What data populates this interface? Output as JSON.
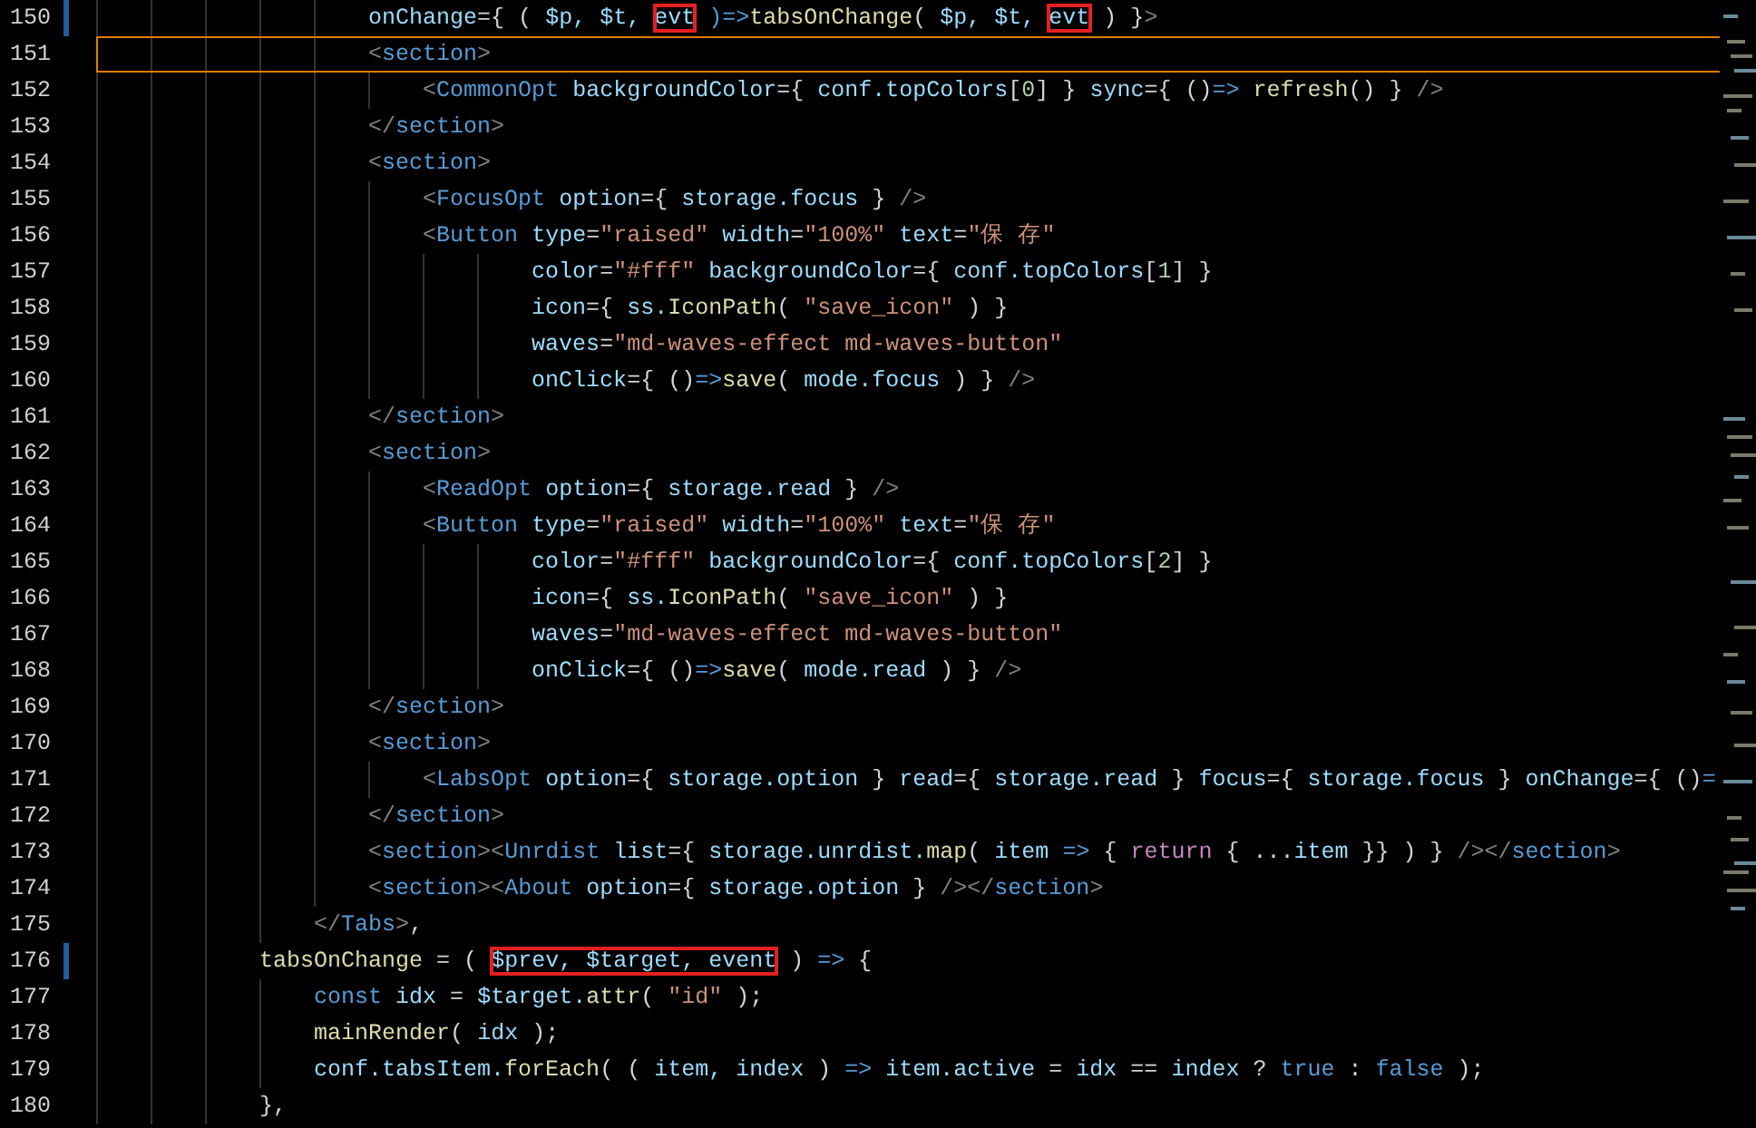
{
  "editor": {
    "lines": [
      {
        "number": "150",
        "modified": true,
        "current": false,
        "tokens": [
          {
            "t": "                      onChange",
            "kind": "attr"
          },
          {
            "t": "={ ( ",
            "kind": "plain"
          },
          {
            "t": "$p, $t, ",
            "kind": "var"
          },
          {
            "t": "evt",
            "kind": "var",
            "boxed": true
          },
          {
            "t": " )=>",
            "kind": "keyword"
          },
          {
            "t": "tabsOnChange",
            "kind": "func"
          },
          {
            "t": "( ",
            "kind": "plain"
          },
          {
            "t": "$p, $t, ",
            "kind": "var"
          },
          {
            "t": "evt",
            "kind": "var",
            "boxed": true
          },
          {
            "t": " ) }",
            "kind": "plain"
          },
          {
            "t": ">",
            "kind": "punct"
          }
        ]
      },
      {
        "number": "151",
        "modified": false,
        "current": true,
        "tokens": [
          {
            "t": "                      <",
            "kind": "punct"
          },
          {
            "t": "section",
            "kind": "tag"
          },
          {
            "t": ">",
            "kind": "punct"
          }
        ]
      },
      {
        "number": "152",
        "modified": false,
        "current": false,
        "tokens": [
          {
            "t": "                          <",
            "kind": "punct"
          },
          {
            "t": "CommonOpt",
            "kind": "tag"
          },
          {
            "t": " backgroundColor",
            "kind": "attr"
          },
          {
            "t": "={ ",
            "kind": "plain"
          },
          {
            "t": "conf.topColors",
            "kind": "var"
          },
          {
            "t": "[",
            "kind": "plain"
          },
          {
            "t": "0",
            "kind": "number"
          },
          {
            "t": "] } ",
            "kind": "plain"
          },
          {
            "t": "sync",
            "kind": "attr"
          },
          {
            "t": "={ ()",
            "kind": "plain"
          },
          {
            "t": "=> ",
            "kind": "keyword"
          },
          {
            "t": "refresh",
            "kind": "func"
          },
          {
            "t": "() } ",
            "kind": "plain"
          },
          {
            "t": "/>",
            "kind": "punct"
          }
        ]
      },
      {
        "number": "153",
        "modified": false,
        "current": false,
        "tokens": [
          {
            "t": "                      </",
            "kind": "punct"
          },
          {
            "t": "section",
            "kind": "tag"
          },
          {
            "t": ">",
            "kind": "punct"
          }
        ]
      },
      {
        "number": "154",
        "modified": false,
        "current": false,
        "tokens": [
          {
            "t": "                      <",
            "kind": "punct"
          },
          {
            "t": "section",
            "kind": "tag"
          },
          {
            "t": ">",
            "kind": "punct"
          }
        ]
      },
      {
        "number": "155",
        "modified": false,
        "current": false,
        "tokens": [
          {
            "t": "                          <",
            "kind": "punct"
          },
          {
            "t": "FocusOpt",
            "kind": "tag"
          },
          {
            "t": " option",
            "kind": "attr"
          },
          {
            "t": "={ ",
            "kind": "plain"
          },
          {
            "t": "storage.focus",
            "kind": "var"
          },
          {
            "t": " } ",
            "kind": "plain"
          },
          {
            "t": "/>",
            "kind": "punct"
          }
        ]
      },
      {
        "number": "156",
        "modified": false,
        "current": false,
        "tokens": [
          {
            "t": "                          <",
            "kind": "punct"
          },
          {
            "t": "Button",
            "kind": "tag"
          },
          {
            "t": " type",
            "kind": "attr"
          },
          {
            "t": "=",
            "kind": "plain"
          },
          {
            "t": "\"raised\"",
            "kind": "string"
          },
          {
            "t": " width",
            "kind": "attr"
          },
          {
            "t": "=",
            "kind": "plain"
          },
          {
            "t": "\"100%\"",
            "kind": "string"
          },
          {
            "t": " text",
            "kind": "attr"
          },
          {
            "t": "=",
            "kind": "plain"
          },
          {
            "t": "\"保 存\"",
            "kind": "string"
          }
        ]
      },
      {
        "number": "157",
        "modified": false,
        "current": false,
        "tokens": [
          {
            "t": "                                  color",
            "kind": "attr"
          },
          {
            "t": "=",
            "kind": "plain"
          },
          {
            "t": "\"#fff\"",
            "kind": "string"
          },
          {
            "t": " backgroundColor",
            "kind": "attr"
          },
          {
            "t": "={ ",
            "kind": "plain"
          },
          {
            "t": "conf.topColors",
            "kind": "var"
          },
          {
            "t": "[",
            "kind": "plain"
          },
          {
            "t": "1",
            "kind": "number"
          },
          {
            "t": "] }",
            "kind": "plain"
          }
        ]
      },
      {
        "number": "158",
        "modified": false,
        "current": false,
        "tokens": [
          {
            "t": "                                  icon",
            "kind": "attr"
          },
          {
            "t": "={ ",
            "kind": "plain"
          },
          {
            "t": "ss.",
            "kind": "var"
          },
          {
            "t": "IconPath",
            "kind": "func"
          },
          {
            "t": "( ",
            "kind": "plain"
          },
          {
            "t": "\"save_icon\"",
            "kind": "string"
          },
          {
            "t": " ) }",
            "kind": "plain"
          }
        ]
      },
      {
        "number": "159",
        "modified": false,
        "current": false,
        "tokens": [
          {
            "t": "                                  waves",
            "kind": "attr"
          },
          {
            "t": "=",
            "kind": "plain"
          },
          {
            "t": "\"md-waves-effect md-waves-button\"",
            "kind": "string"
          }
        ]
      },
      {
        "number": "160",
        "modified": false,
        "current": false,
        "tokens": [
          {
            "t": "                                  onClick",
            "kind": "attr"
          },
          {
            "t": "={ ()",
            "kind": "plain"
          },
          {
            "t": "=>",
            "kind": "keyword"
          },
          {
            "t": "save",
            "kind": "func"
          },
          {
            "t": "( ",
            "kind": "plain"
          },
          {
            "t": "mode.focus",
            "kind": "var"
          },
          {
            "t": " ) } ",
            "kind": "plain"
          },
          {
            "t": "/>",
            "kind": "punct"
          }
        ]
      },
      {
        "number": "161",
        "modified": false,
        "current": false,
        "tokens": [
          {
            "t": "                      </",
            "kind": "punct"
          },
          {
            "t": "section",
            "kind": "tag"
          },
          {
            "t": ">",
            "kind": "punct"
          }
        ]
      },
      {
        "number": "162",
        "modified": false,
        "current": false,
        "tokens": [
          {
            "t": "                      <",
            "kind": "punct"
          },
          {
            "t": "section",
            "kind": "tag"
          },
          {
            "t": ">",
            "kind": "punct"
          }
        ]
      },
      {
        "number": "163",
        "modified": false,
        "current": false,
        "tokens": [
          {
            "t": "                          <",
            "kind": "punct"
          },
          {
            "t": "ReadOpt",
            "kind": "tag"
          },
          {
            "t": " option",
            "kind": "attr"
          },
          {
            "t": "={ ",
            "kind": "plain"
          },
          {
            "t": "storage.read",
            "kind": "var"
          },
          {
            "t": " } ",
            "kind": "plain"
          },
          {
            "t": "/>",
            "kind": "punct"
          }
        ]
      },
      {
        "number": "164",
        "modified": false,
        "current": false,
        "tokens": [
          {
            "t": "                          <",
            "kind": "punct"
          },
          {
            "t": "Button",
            "kind": "tag"
          },
          {
            "t": " type",
            "kind": "attr"
          },
          {
            "t": "=",
            "kind": "plain"
          },
          {
            "t": "\"raised\"",
            "kind": "string"
          },
          {
            "t": " width",
            "kind": "attr"
          },
          {
            "t": "=",
            "kind": "plain"
          },
          {
            "t": "\"100%\"",
            "kind": "string"
          },
          {
            "t": " text",
            "kind": "attr"
          },
          {
            "t": "=",
            "kind": "plain"
          },
          {
            "t": "\"保 存\"",
            "kind": "string"
          }
        ]
      },
      {
        "number": "165",
        "modified": false,
        "current": false,
        "tokens": [
          {
            "t": "                                  color",
            "kind": "attr"
          },
          {
            "t": "=",
            "kind": "plain"
          },
          {
            "t": "\"#fff\"",
            "kind": "string"
          },
          {
            "t": " backgroundColor",
            "kind": "attr"
          },
          {
            "t": "={ ",
            "kind": "plain"
          },
          {
            "t": "conf.topColors",
            "kind": "var"
          },
          {
            "t": "[",
            "kind": "plain"
          },
          {
            "t": "2",
            "kind": "number"
          },
          {
            "t": "] }",
            "kind": "plain"
          }
        ]
      },
      {
        "number": "166",
        "modified": false,
        "current": false,
        "tokens": [
          {
            "t": "                                  icon",
            "kind": "attr"
          },
          {
            "t": "={ ",
            "kind": "plain"
          },
          {
            "t": "ss.",
            "kind": "var"
          },
          {
            "t": "IconPath",
            "kind": "func"
          },
          {
            "t": "( ",
            "kind": "plain"
          },
          {
            "t": "\"save_icon\"",
            "kind": "string"
          },
          {
            "t": " ) }",
            "kind": "plain"
          }
        ]
      },
      {
        "number": "167",
        "modified": false,
        "current": false,
        "tokens": [
          {
            "t": "                                  waves",
            "kind": "attr"
          },
          {
            "t": "=",
            "kind": "plain"
          },
          {
            "t": "\"md-waves-effect md-waves-button\"",
            "kind": "string"
          }
        ]
      },
      {
        "number": "168",
        "modified": false,
        "current": false,
        "tokens": [
          {
            "t": "                                  onClick",
            "kind": "attr"
          },
          {
            "t": "={ ()",
            "kind": "plain"
          },
          {
            "t": "=>",
            "kind": "keyword"
          },
          {
            "t": "save",
            "kind": "func"
          },
          {
            "t": "( ",
            "kind": "plain"
          },
          {
            "t": "mode.read",
            "kind": "var"
          },
          {
            "t": " ) } ",
            "kind": "plain"
          },
          {
            "t": "/>",
            "kind": "punct"
          }
        ]
      },
      {
        "number": "169",
        "modified": false,
        "current": false,
        "tokens": [
          {
            "t": "                      </",
            "kind": "punct"
          },
          {
            "t": "section",
            "kind": "tag"
          },
          {
            "t": ">",
            "kind": "punct"
          }
        ]
      },
      {
        "number": "170",
        "modified": false,
        "current": false,
        "tokens": [
          {
            "t": "                      <",
            "kind": "punct"
          },
          {
            "t": "section",
            "kind": "tag"
          },
          {
            "t": ">",
            "kind": "punct"
          }
        ]
      },
      {
        "number": "171",
        "modified": false,
        "current": false,
        "tokens": [
          {
            "t": "                          <",
            "kind": "punct"
          },
          {
            "t": "LabsOpt",
            "kind": "tag"
          },
          {
            "t": " option",
            "kind": "attr"
          },
          {
            "t": "={ ",
            "kind": "plain"
          },
          {
            "t": "storage.option",
            "kind": "var"
          },
          {
            "t": " } ",
            "kind": "plain"
          },
          {
            "t": "read",
            "kind": "attr"
          },
          {
            "t": "={ ",
            "kind": "plain"
          },
          {
            "t": "storage.read",
            "kind": "var"
          },
          {
            "t": " } ",
            "kind": "plain"
          },
          {
            "t": "focus",
            "kind": "attr"
          },
          {
            "t": "={ ",
            "kind": "plain"
          },
          {
            "t": "storage.focus",
            "kind": "var"
          },
          {
            "t": " } ",
            "kind": "plain"
          },
          {
            "t": "onChange",
            "kind": "attr"
          },
          {
            "t": "={ ()",
            "kind": "plain"
          },
          {
            "t": "=",
            "kind": "keyword"
          }
        ]
      },
      {
        "number": "172",
        "modified": false,
        "current": false,
        "tokens": [
          {
            "t": "                      </",
            "kind": "punct"
          },
          {
            "t": "section",
            "kind": "tag"
          },
          {
            "t": ">",
            "kind": "punct"
          }
        ]
      },
      {
        "number": "173",
        "modified": false,
        "current": false,
        "tokens": [
          {
            "t": "                      <",
            "kind": "punct"
          },
          {
            "t": "section",
            "kind": "tag"
          },
          {
            "t": "><",
            "kind": "punct"
          },
          {
            "t": "Unrdist",
            "kind": "tag"
          },
          {
            "t": " list",
            "kind": "attr"
          },
          {
            "t": "={ ",
            "kind": "plain"
          },
          {
            "t": "storage.unrdist.",
            "kind": "var"
          },
          {
            "t": "map",
            "kind": "func"
          },
          {
            "t": "( ",
            "kind": "plain"
          },
          {
            "t": "item",
            "kind": "var"
          },
          {
            "t": " => ",
            "kind": "keyword"
          },
          {
            "t": "{ ",
            "kind": "plain"
          },
          {
            "t": "return",
            "kind": "control"
          },
          {
            "t": " { ...",
            "kind": "plain"
          },
          {
            "t": "item",
            "kind": "var"
          },
          {
            "t": " }} ) } ",
            "kind": "plain"
          },
          {
            "t": "/></",
            "kind": "punct"
          },
          {
            "t": "section",
            "kind": "tag"
          },
          {
            "t": ">",
            "kind": "punct"
          }
        ]
      },
      {
        "number": "174",
        "modified": false,
        "current": false,
        "tokens": [
          {
            "t": "                      <",
            "kind": "punct"
          },
          {
            "t": "section",
            "kind": "tag"
          },
          {
            "t": "><",
            "kind": "punct"
          },
          {
            "t": "About",
            "kind": "tag"
          },
          {
            "t": " option",
            "kind": "attr"
          },
          {
            "t": "={ ",
            "kind": "plain"
          },
          {
            "t": "storage.option",
            "kind": "var"
          },
          {
            "t": " } ",
            "kind": "plain"
          },
          {
            "t": "/></",
            "kind": "punct"
          },
          {
            "t": "section",
            "kind": "tag"
          },
          {
            "t": ">",
            "kind": "punct"
          }
        ]
      },
      {
        "number": "175",
        "modified": false,
        "current": false,
        "tokens": [
          {
            "t": "                  </",
            "kind": "punct"
          },
          {
            "t": "Tabs",
            "kind": "tag"
          },
          {
            "t": ">",
            "kind": "punct"
          },
          {
            "t": ",",
            "kind": "plain"
          }
        ]
      },
      {
        "number": "176",
        "modified": true,
        "current": false,
        "tokens": [
          {
            "t": "              tabsOnChange",
            "kind": "func"
          },
          {
            "t": " = ( ",
            "kind": "plain"
          },
          {
            "t": "$prev, $target, event",
            "kind": "var",
            "boxed": true
          },
          {
            "t": " ) ",
            "kind": "plain"
          },
          {
            "t": "=>",
            "kind": "keyword"
          },
          {
            "t": " {",
            "kind": "plain"
          }
        ]
      },
      {
        "number": "177",
        "modified": false,
        "current": false,
        "tokens": [
          {
            "t": "                  const",
            "kind": "keyword"
          },
          {
            "t": " idx",
            "kind": "var"
          },
          {
            "t": " = ",
            "kind": "plain"
          },
          {
            "t": "$target.",
            "kind": "var"
          },
          {
            "t": "attr",
            "kind": "func"
          },
          {
            "t": "( ",
            "kind": "plain"
          },
          {
            "t": "\"id\"",
            "kind": "string"
          },
          {
            "t": " );",
            "kind": "plain"
          }
        ]
      },
      {
        "number": "178",
        "modified": false,
        "current": false,
        "tokens": [
          {
            "t": "                  mainRender",
            "kind": "func"
          },
          {
            "t": "( ",
            "kind": "plain"
          },
          {
            "t": "idx",
            "kind": "var"
          },
          {
            "t": " );",
            "kind": "plain"
          }
        ]
      },
      {
        "number": "179",
        "modified": false,
        "current": false,
        "tokens": [
          {
            "t": "                  conf.tabsItem.",
            "kind": "var"
          },
          {
            "t": "forEach",
            "kind": "func"
          },
          {
            "t": "( ( ",
            "kind": "plain"
          },
          {
            "t": "item, index",
            "kind": "var"
          },
          {
            "t": " ) ",
            "kind": "plain"
          },
          {
            "t": "=>",
            "kind": "keyword"
          },
          {
            "t": " item.active",
            "kind": "var"
          },
          {
            "t": " = ",
            "kind": "plain"
          },
          {
            "t": "idx",
            "kind": "var"
          },
          {
            "t": " == ",
            "kind": "plain"
          },
          {
            "t": "index",
            "kind": "var"
          },
          {
            "t": " ? ",
            "kind": "plain"
          },
          {
            "t": "true",
            "kind": "keyword"
          },
          {
            "t": " : ",
            "kind": "plain"
          },
          {
            "t": "false",
            "kind": "keyword"
          },
          {
            "t": " );",
            "kind": "plain"
          }
        ]
      },
      {
        "number": "180",
        "modified": false,
        "current": false,
        "tokens": [
          {
            "t": "              },",
            "kind": "plain"
          }
        ]
      }
    ]
  }
}
